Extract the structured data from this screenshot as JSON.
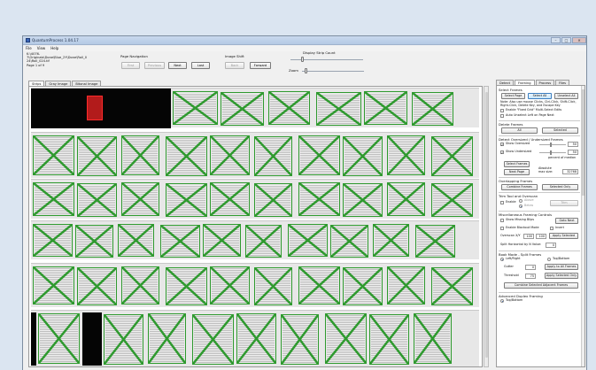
{
  "window": {
    "title": "QuantumProcess 1.04.17",
    "controls": {
      "minimize": "–",
      "maximize": "□",
      "close": "✕"
    },
    "app_icon": "app-logo-icon"
  },
  "menu": [
    "File",
    "View",
    "Help"
  ],
  "info": {
    "path_line1": "K:\\4076-7\\Originals\\Done\\Blue_2Y\\Done\\Roll_0",
    "path_line2": "24\\Roll_024.tif",
    "page_count": "Page 1 of 9"
  },
  "page_nav": {
    "label": "Page Navigation",
    "first": "First",
    "previous": "Previous",
    "next": "Next",
    "last": "Last"
  },
  "image_shift": {
    "label": "Image Shift",
    "back": "Back",
    "forward": "Forward"
  },
  "display_strip": {
    "label": "Display Strip Count",
    "value_fraction": 0.15
  },
  "zoom": {
    "label": "Zoom",
    "value_fraction": 0.05
  },
  "viewer_tabs": [
    "Strips",
    "Gray Image",
    "Bitonal Image"
  ],
  "right_tabs": [
    "Detect",
    "Framing",
    "Process",
    "Files"
  ],
  "panel": {
    "select_frames": {
      "title": "Select Frames",
      "select_page": "Select Page",
      "select_all": "Select All",
      "unselect_all": "Unselect All",
      "note": "Note: Also use mouse Clicks, Ctrl-Click, Shift-Click, Right-Click, Delete Key, and Escape Key",
      "enable_fixed_grid": "Enable \"Fixed Grid\" Multi-Select Edits",
      "auto_unselect": "Auto Unselect Left on Page Next"
    },
    "delete_frames": {
      "title": "Delete Frames",
      "all": "All",
      "selected": "Selected"
    },
    "detect_oversized": {
      "title": "Detect Oversized / Undersized Frames",
      "show_oversized": "Show Oversized",
      "oversized_value": "50",
      "show_undersized": "Show Undersized",
      "undersized_value": "50",
      "percent_of_median": "percent of median",
      "select_frames": "Select Frames",
      "next_page": "Next Page",
      "absolute_max_size_label": "Absolute max size:",
      "absolute_max_size": "32768"
    },
    "overlapping": {
      "title": "Overlapping Frames",
      "combine": "Combine Frames",
      "selected_only": "Selected Only"
    },
    "trim_tool": {
      "title": "Trim Tool and Overscan",
      "enable": "Enable",
      "above": "Above",
      "below": "Below",
      "trim": "Trim"
    },
    "misc": {
      "title": "Miscellaneous Framing Controls",
      "show_missing_blips": "Show Missing Blips",
      "goto_next": "Goto Next",
      "enable_blackout": "Enable Blackout Mode",
      "invert": "Invert",
      "overscan_label": "Overscan X/Y",
      "overscan_x": "100",
      "overscan_y": "100",
      "apply_selected": "Apply Selected",
      "split_label": "Split Horizontal by N Value:",
      "split_value": "0"
    },
    "book_mode": {
      "title": "Book Mode - Split Frames",
      "left_right": "Left/Right",
      "top_bottom": "Top/Bottom",
      "gutter_label": "Gutter",
      "gutter_value": "0",
      "apply_all": "Apply to All Frames",
      "threshold_label": "Threshold",
      "threshold_value": "75",
      "apply_selected_only": "Apply Selected Only",
      "combine_adjacent": "Combine Selected Adjacent Frames"
    },
    "advanced": {
      "title": "Advanced Duplex Framing",
      "top_bottom": "Top/Bottom"
    }
  }
}
